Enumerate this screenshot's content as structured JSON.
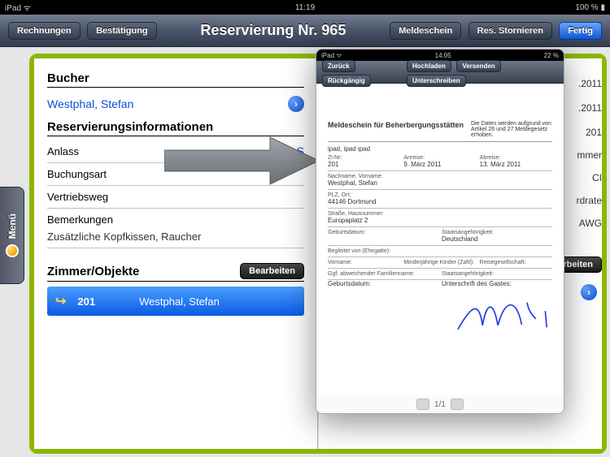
{
  "statusbar": {
    "device": "iPad",
    "time": "11:19",
    "battery": "100 %"
  },
  "toolbar": {
    "left": {
      "rechnungen": "Rechnungen",
      "bestatigung": "Bestätigung"
    },
    "title": "Reservierung Nr. 965",
    "right": {
      "meldeschein": "Meldeschein",
      "stornieren": "Res. Stornieren",
      "fertig": "Fertig"
    }
  },
  "menu_tab": "Menü",
  "left_page": {
    "bucher_header": "Bucher",
    "bucher_name": "Westphal, Stefan",
    "resinfo_header": "Reservierungsinformationen",
    "fields": {
      "anlass": "Anlass",
      "anlass_val": "S",
      "buchungsart": "Buchungsart",
      "vertriebsweg": "Vertriebsweg",
      "bemerkungen": "Bemerkungen",
      "bemerkungen_val": "Zusätzliche Kopfkissen, Raucher"
    },
    "rooms_header": "Zimmer/Objekte",
    "bearbeiten": "Bearbeiten",
    "room": {
      "number": "201",
      "guest": "Westphal, Stefan"
    }
  },
  "right_page": {
    "date1": ".2011",
    "date2": ".2011",
    "code1": "201",
    "code2": "mmer",
    "code3": "CI",
    "code4": "rdrate",
    "code5": "AWG",
    "bearbeiten": "rbeiten"
  },
  "overlay": {
    "status": {
      "device": "iPad",
      "time": "14:05",
      "battery": "22 %"
    },
    "toolbar": {
      "back": "Zurück",
      "undo": "Rückgängig",
      "upload": "Hochladen",
      "send": "Versenden",
      "sign": "Unterschreiben"
    },
    "form": {
      "title": "Meldeschein für Beherbergungsstätten",
      "note": "Die Daten werden aufgrund von Artikel 26 und 27 Meldegesetz erhoben.",
      "hotel": "ipad, ipad ipad",
      "zinr_lbl": "Zi-Nr:",
      "zinr": "201",
      "arrival_lbl": "Anreise:",
      "arrival": "9. März 2011",
      "depart_lbl": "Abreise:",
      "depart": "13. März 2011",
      "name_lbl": "Nachname, Vorname:",
      "name": "Westphal, Stefan",
      "city_lbl": "PLZ, Ort:",
      "city": "44146 Dortmund",
      "street_lbl": "Straße, Hausnummer:",
      "street": "Europaplatz 2",
      "birth_lbl": "Geburtsdatum:",
      "nation_lbl": "Staatsangehörigkeit:",
      "nation": "Deutschland",
      "spouse_lbl": "Begleitet von (Ehegatte):",
      "vorname_lbl": "Vorname:",
      "children_lbl": "Minderjährige Kinder (Zahl):",
      "travel_lbl": "Reisegesellschaft:",
      "altname_lbl": "Ggf. abweichender Familienname:",
      "nation2_lbl": "Staatsangehörigkeit:",
      "birth2_lbl": "Geburtsdatum:",
      "sig_lbl": "Unterschrift des Gastes:"
    },
    "pager": "1/1"
  }
}
